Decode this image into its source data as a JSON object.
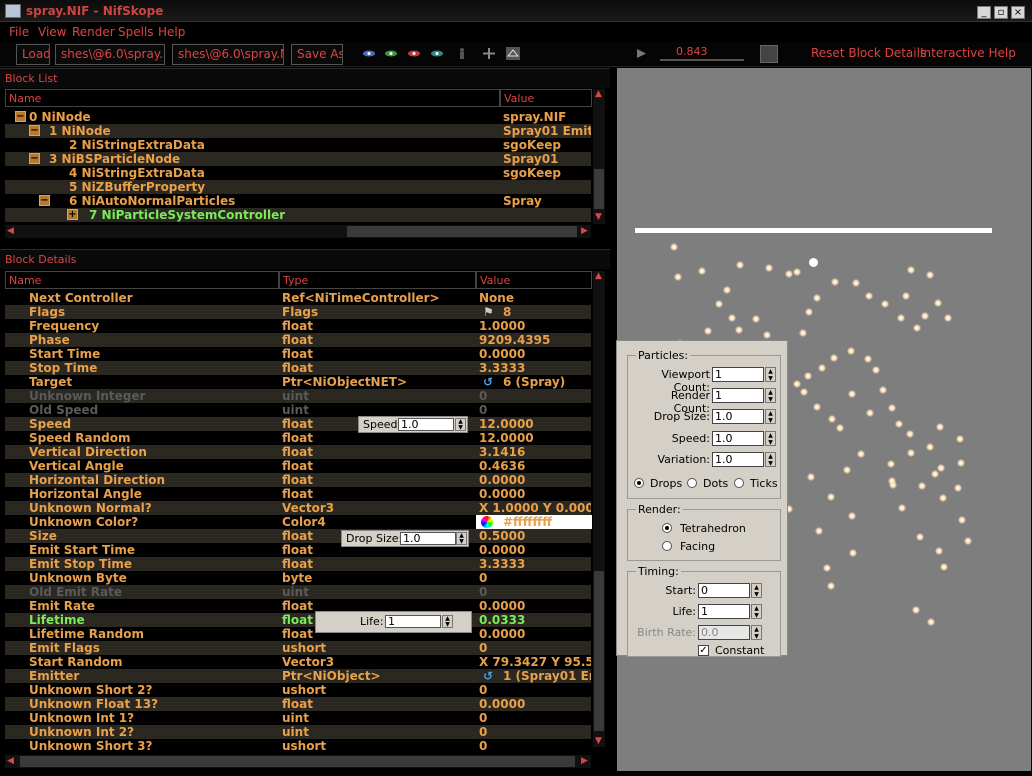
{
  "window": {
    "title": "spray.NIF - NifSkope"
  },
  "menu": [
    "File",
    "View",
    "Render",
    "Spells",
    "Help"
  ],
  "toolbar": {
    "load": "Load",
    "path1": "shes\\@6.0\\spray.NIF",
    "path2": "shes\\@6.0\\spray.NIF",
    "save_as": "Save As",
    "time_value": "0.843",
    "reset_block_details": "Reset Block Details",
    "interactive_help": "Interactive Help"
  },
  "block_list": {
    "title": "Block List",
    "headers": {
      "name": "Name",
      "value": "Value"
    },
    "rows": [
      {
        "name": "0 NiNode",
        "value": "spray.NIF",
        "toggle": "−"
      },
      {
        "name": "1 NiNode",
        "value": "Spray01 Emitt",
        "toggle": "−"
      },
      {
        "name": "2 NiStringExtraData",
        "value": "sgoKeep",
        "toggle": ""
      },
      {
        "name": "3 NiBSParticleNode",
        "value": "Spray01",
        "toggle": "−"
      },
      {
        "name": "4 NiStringExtraData",
        "value": "sgoKeep",
        "toggle": ""
      },
      {
        "name": "5 NiZBufferProperty",
        "value": "",
        "toggle": ""
      },
      {
        "name": "6 NiAutoNormalParticles",
        "value": "Spray",
        "toggle": "−"
      },
      {
        "name": "7 NiParticleSystemController",
        "value": "",
        "toggle": "+"
      }
    ]
  },
  "block_details": {
    "title": "Block Details",
    "headers": {
      "name": "Name",
      "type": "Type",
      "value": "Value"
    },
    "rows": [
      {
        "name": "Next Controller",
        "type": "Ref<NiTimeController>",
        "value": "None"
      },
      {
        "name": "Flags",
        "type": "Flags",
        "value": "8"
      },
      {
        "name": "Frequency",
        "type": "float",
        "value": "1.0000"
      },
      {
        "name": "Phase",
        "type": "float",
        "value": "9209.4395"
      },
      {
        "name": "Start Time",
        "type": "float",
        "value": "0.0000"
      },
      {
        "name": "Stop Time",
        "type": "float",
        "value": "3.3333"
      },
      {
        "name": "Target",
        "type": "Ptr<NiObjectNET>",
        "value": "6 (Spray)"
      },
      {
        "name": "Unknown Integer",
        "type": "uint",
        "value": "0"
      },
      {
        "name": "Old Speed",
        "type": "uint",
        "value": "0"
      },
      {
        "name": "Speed",
        "type": "float",
        "value": "12.0000"
      },
      {
        "name": "Speed Random",
        "type": "float",
        "value": "12.0000"
      },
      {
        "name": "Vertical Direction",
        "type": "float",
        "value": "3.1416"
      },
      {
        "name": "Vertical Angle",
        "type": "float",
        "value": "0.4636"
      },
      {
        "name": "Horizontal Direction",
        "type": "float",
        "value": "0.0000"
      },
      {
        "name": "Horizontal Angle",
        "type": "float",
        "value": "0.0000"
      },
      {
        "name": "Unknown Normal?",
        "type": "Vector3",
        "value": "X 1.0000 Y 0.0000"
      },
      {
        "name": "Unknown Color?",
        "type": "Color4",
        "value": "#ffffffff"
      },
      {
        "name": "Size",
        "type": "float",
        "value": "0.5000"
      },
      {
        "name": "Emit Start Time",
        "type": "float",
        "value": "0.0000"
      },
      {
        "name": "Emit Stop Time",
        "type": "float",
        "value": "3.3333"
      },
      {
        "name": "Unknown Byte",
        "type": "byte",
        "value": "0"
      },
      {
        "name": "Old Emit Rate",
        "type": "uint",
        "value": "0"
      },
      {
        "name": "Emit Rate",
        "type": "float",
        "value": "0.0000"
      },
      {
        "name": "Lifetime",
        "type": "float",
        "value": "0.0333"
      },
      {
        "name": "Lifetime Random",
        "type": "float",
        "value": "0.0000"
      },
      {
        "name": "Emit Flags",
        "type": "ushort",
        "value": "0"
      },
      {
        "name": "Start Random",
        "type": "Vector3",
        "value": "X 79.3427 Y 95.51"
      },
      {
        "name": "Emitter",
        "type": "Ptr<NiObject>",
        "value": "1 (Spray01 Em"
      },
      {
        "name": "Unknown Short 2?",
        "type": "ushort",
        "value": "0"
      },
      {
        "name": "Unknown Float 13?",
        "type": "float",
        "value": "0.0000"
      },
      {
        "name": "Unknown Int 1?",
        "type": "uint",
        "value": "0"
      },
      {
        "name": "Unknown Int 2?",
        "type": "uint",
        "value": "0"
      },
      {
        "name": "Unknown Short 3?",
        "type": "ushort",
        "value": "0"
      }
    ]
  },
  "overlays": {
    "speed": {
      "label": "Speed:",
      "value": "1.0"
    },
    "drop_size": {
      "label": "Drop Size:",
      "value": "1.0"
    },
    "life": {
      "label": "Life:",
      "value": "1"
    }
  },
  "particles_dialog": {
    "particles_title": "Particles:",
    "viewport_count_label": "Viewport Count:",
    "viewport_count": "1",
    "render_count_label": "Render Count:",
    "render_count": "1",
    "drop_size_label": "Drop Size:",
    "drop_size": "1.0",
    "speed_label": "Speed:",
    "speed": "1.0",
    "variation_label": "Variation:",
    "variation": "1.0",
    "drops": "Drops",
    "dots": "Dots",
    "ticks": "Ticks",
    "render_title": "Render:",
    "tetrahedron": "Tetrahedron",
    "facing": "Facing",
    "timing_title": "Timing:",
    "start_label": "Start:",
    "start": "0",
    "life_label": "Life:",
    "life": "1",
    "birth_rate_label": "Birth Rate:",
    "birth_rate": "0.0",
    "constant": "Constant"
  }
}
